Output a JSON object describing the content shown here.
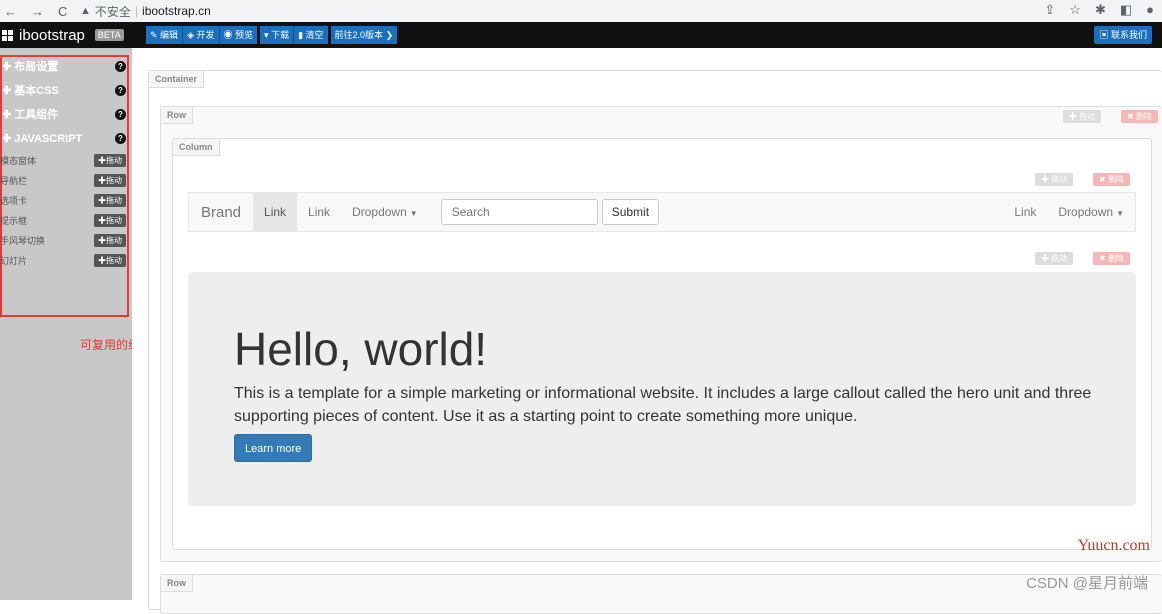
{
  "browser": {
    "security_label": "不安全",
    "url": "ibootstrap.cn"
  },
  "topnav": {
    "brand": "ibootstrap",
    "beta": "BETA",
    "group1": [
      "编辑",
      "开发",
      "预览"
    ],
    "group2": [
      "下载",
      "清空"
    ],
    "version_btn": "前往2.0版本",
    "contact": "联系我们"
  },
  "sidebar": {
    "sections": [
      "布局设置",
      "基本CSS",
      "工具组件",
      "JAVASCRIPT"
    ],
    "items": [
      "模态窗体",
      "导航栏",
      "选项卡",
      "提示框",
      "手风琴切换",
      "幻灯片"
    ],
    "drag_label": "拖动",
    "annotation": "可复用的组件"
  },
  "canvas": {
    "container_tag": "Container",
    "row_tag": "Row",
    "column_tag": "Column",
    "drag_label": "拖动",
    "delete_label": "删除"
  },
  "demo_nav": {
    "brand": "Brand",
    "links_left": [
      "Link",
      "Link"
    ],
    "dropdown": "Dropdown",
    "search_placeholder": "Search",
    "submit": "Submit",
    "link_right": "Link",
    "dropdown_right": "Dropdown"
  },
  "jumbotron": {
    "heading": "Hello, world!",
    "text": "This is a template for a simple marketing or informational website. It includes a large callout called the hero unit and three supporting pieces of content. Use it as a starting point to create something more unique.",
    "button": "Learn more"
  },
  "watermarks": {
    "yuucn": "Yuucn.com",
    "csdn": "CSDN @星月前端"
  },
  "colors": {
    "accent": "#1a6fbf",
    "annotation_red": "#e53935",
    "primary_button": "#337ab7"
  }
}
